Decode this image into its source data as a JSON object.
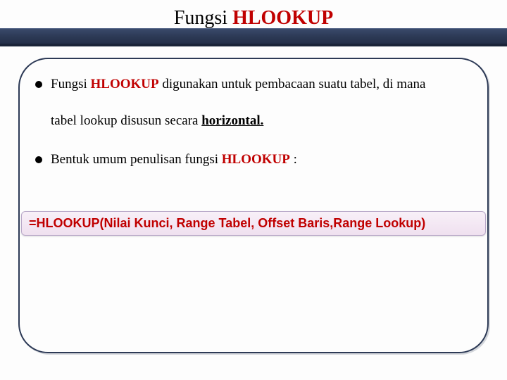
{
  "title": {
    "prefix": "Fungsi ",
    "highlight": "HLOOKUP"
  },
  "bullets": [
    {
      "t1": "Fungsi ",
      "bold": "HLOOKUP",
      "t2": " digunakan untuk pembacaan suatu tabel, di mana",
      "line2a": "tabel lookup disusun secara ",
      "underline": "horizontal."
    },
    {
      "t1": "Bentuk umum penulisan fungsi ",
      "bold": "HLOOKUP",
      "t2": " :"
    }
  ],
  "formula": "=HLOOKUP(Nilai Kunci, Range Tabel, Offset Baris,Range Lookup)"
}
